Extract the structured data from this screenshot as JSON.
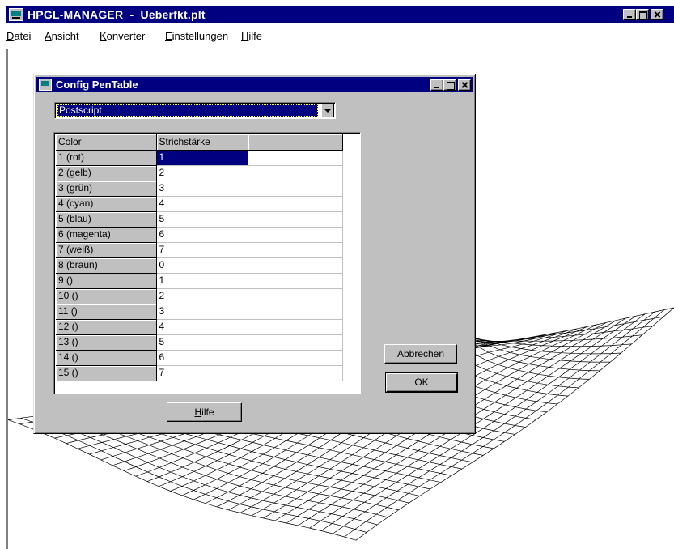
{
  "window": {
    "title": "HPGL-MANAGER  -  Ueberfkt.plt",
    "icon": "app-icon"
  },
  "menu": [
    {
      "label": "Datei",
      "mnemonic": "D"
    },
    {
      "label": "Ansicht",
      "mnemonic": "A"
    },
    {
      "label": "Konverter",
      "mnemonic": "K"
    },
    {
      "label": "Einstellungen",
      "mnemonic": "E"
    },
    {
      "label": "Hilfe",
      "mnemonic": "H"
    }
  ],
  "dialog": {
    "title": "Config PenTable",
    "format_select": {
      "value": "Postscript"
    },
    "table": {
      "columns": [
        "Color",
        "Strichstärke",
        ""
      ],
      "rows": [
        {
          "color": "1 (rot)",
          "width": "1"
        },
        {
          "color": "2 (gelb)",
          "width": "2"
        },
        {
          "color": "3 (grün)",
          "width": "3"
        },
        {
          "color": "4 (cyan)",
          "width": "4"
        },
        {
          "color": "5 (blau)",
          "width": "5"
        },
        {
          "color": "6 (magenta)",
          "width": "6"
        },
        {
          "color": "7 (weiß)",
          "width": "7"
        },
        {
          "color": "8 (braun)",
          "width": "0"
        },
        {
          "color": "9 ()",
          "width": "1"
        },
        {
          "color": "10 ()",
          "width": "2"
        },
        {
          "color": "11 ()",
          "width": "3"
        },
        {
          "color": "12 ()",
          "width": "4"
        },
        {
          "color": "13 ()",
          "width": "5"
        },
        {
          "color": "14 ()",
          "width": "6"
        },
        {
          "color": "15 ()",
          "width": "7"
        }
      ],
      "selected_row": 0
    },
    "buttons": {
      "cancel": "Abbrechen",
      "ok": "OK",
      "help": "Hilfe"
    }
  },
  "colors": {
    "titlebar": "#000080",
    "face": "#c0c0c0",
    "selection": "#000080"
  }
}
